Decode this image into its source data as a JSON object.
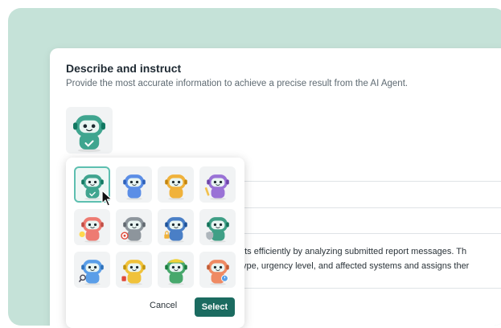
{
  "panel": {
    "title": "Describe and instruct",
    "subtitle": "Provide the most accurate information to achieve a precise result from the AI Agent."
  },
  "description": {
    "line1": "nts efficiently by analyzing submitted report messages. Th",
    "line2": "type, urgency level, and affected systems and assigns ther"
  },
  "avatar_picker": {
    "cancel_label": "Cancel",
    "select_label": "Select",
    "selected_index": 0,
    "avatars": [
      {
        "name": "teal-robot",
        "color": "#3fa58f",
        "accessory": "check"
      },
      {
        "name": "blue-robot",
        "color": "#5b8ee6",
        "accessory": "none"
      },
      {
        "name": "yellow-robot",
        "color": "#f0b23b",
        "accessory": "none"
      },
      {
        "name": "purple-robot",
        "color": "#9a72d6",
        "accessory": "pencil"
      },
      {
        "name": "red-robot",
        "color": "#ee7b72",
        "accessory": "bulb"
      },
      {
        "name": "gray-robot",
        "color": "#8d959c",
        "accessory": "target"
      },
      {
        "name": "navy-robot",
        "color": "#4a7fc6",
        "accessory": "lock"
      },
      {
        "name": "green-robot",
        "color": "#3f9f86",
        "accessory": "shield"
      },
      {
        "name": "blue-magnifier-robot",
        "color": "#5a9ee8",
        "accessory": "magnifier"
      },
      {
        "name": "yellow-red-robot",
        "color": "#f0c23a",
        "accessory": "red-item"
      },
      {
        "name": "green-helmet-robot",
        "color": "#47a86c",
        "accessory": "helmet"
      },
      {
        "name": "orange-robot",
        "color": "#ef8a63",
        "accessory": "clock"
      }
    ]
  },
  "main_avatar": {
    "name": "teal-robot",
    "color": "#3fa58f"
  }
}
